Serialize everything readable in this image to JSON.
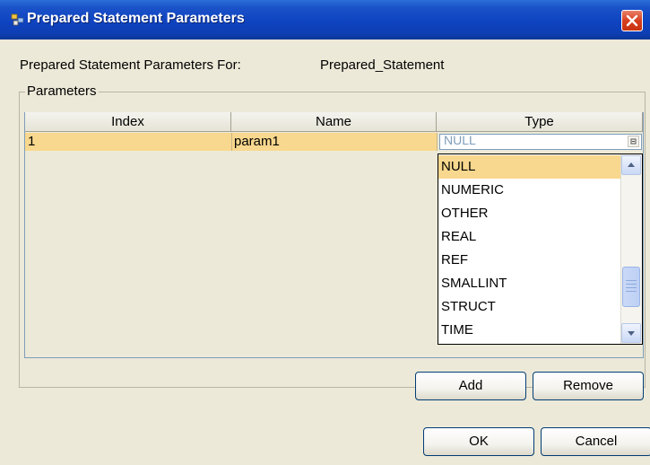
{
  "window": {
    "title": "Prepared Statement Parameters",
    "accent_color": "#0f43c0",
    "close_icon": "close-icon",
    "app_icon": "app-icon"
  },
  "header": {
    "for_label": "Prepared Statement Parameters For:",
    "statement_name": "Prepared_Statement"
  },
  "parameters": {
    "group_label": "Parameters",
    "columns": [
      "Index",
      "Name",
      "Type"
    ],
    "rows": [
      {
        "index": "1",
        "name": "param1",
        "type": "NULL"
      }
    ]
  },
  "type_dropdown": {
    "current_value": "NULL",
    "selected": "NULL",
    "selection_color": "#f8d88e",
    "visible_options": [
      "NULL",
      "NUMERIC",
      "OTHER",
      "REAL",
      "REF",
      "SMALLINT",
      "STRUCT",
      "TIME"
    ]
  },
  "buttons": {
    "add": "Add",
    "remove": "Remove",
    "ok": "OK",
    "cancel": "Cancel"
  }
}
